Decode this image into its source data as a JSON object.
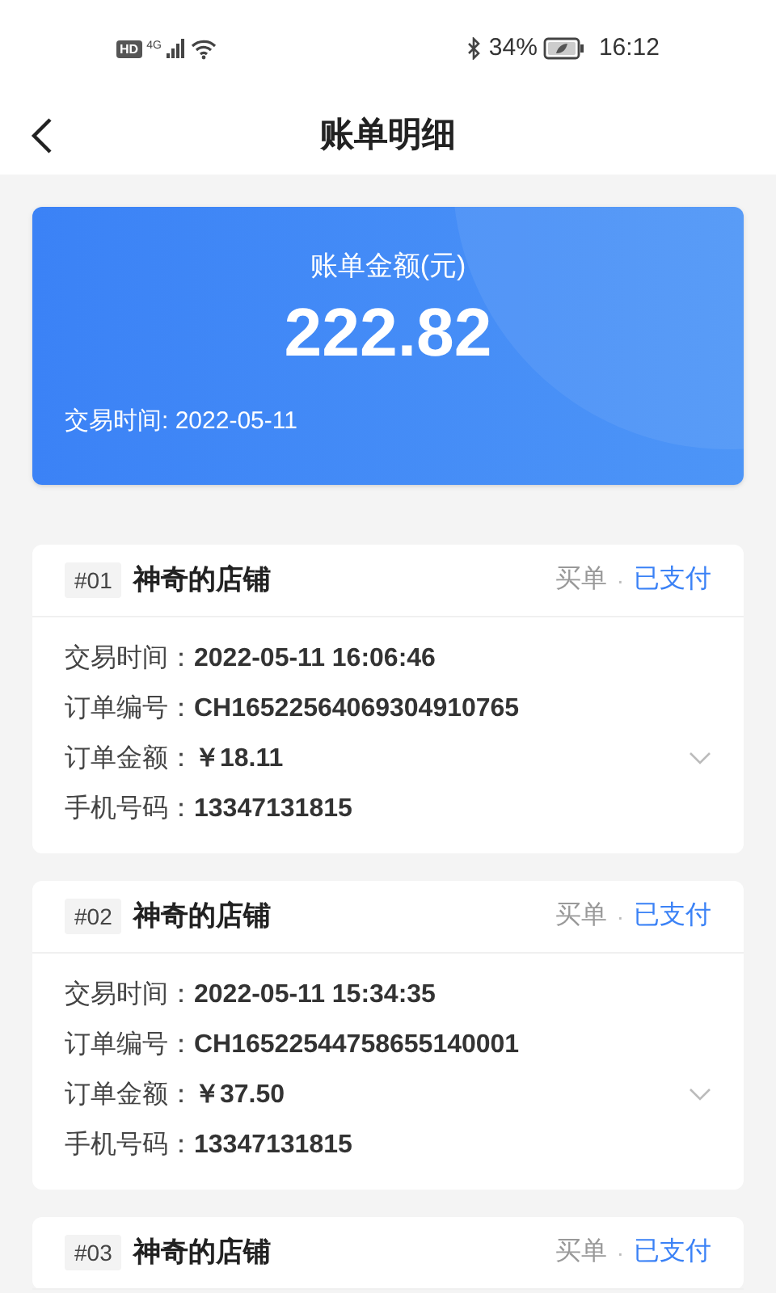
{
  "status_bar": {
    "hd_label": "HD",
    "network_label": "4G",
    "battery": "34%",
    "time": "16:12"
  },
  "nav": {
    "title": "账单明细"
  },
  "summary": {
    "label": "账单金额(元)",
    "amount": "222.82",
    "date": "交易时间: 2022-05-11"
  },
  "orders": [
    {
      "index": "#01",
      "shop": "神奇的店铺",
      "type": "买单",
      "separator": "·",
      "status": "已支付",
      "expanded": false,
      "fields": [
        {
          "label": "交易时间：",
          "value": "2022-05-11 16:06:46"
        },
        {
          "label": "订单编号：",
          "value": "CH16522564069304910765"
        },
        {
          "label": "订单金额：",
          "value": "￥18.11"
        },
        {
          "label": "手机号码：",
          "value": "13347131815"
        }
      ]
    },
    {
      "index": "#02",
      "shop": "神奇的店铺",
      "type": "买单",
      "separator": "·",
      "status": "已支付",
      "expanded": false,
      "fields": [
        {
          "label": "交易时间：",
          "value": "2022-05-11 15:34:35"
        },
        {
          "label": "订单编号：",
          "value": "CH16522544758655140001"
        },
        {
          "label": "订单金额：",
          "value": "￥37.50"
        },
        {
          "label": "手机号码：",
          "value": "13347131815"
        }
      ]
    },
    {
      "index": "#03",
      "shop": "神奇的店铺",
      "type": "买单",
      "separator": "·",
      "status": "已支付"
    }
  ]
}
